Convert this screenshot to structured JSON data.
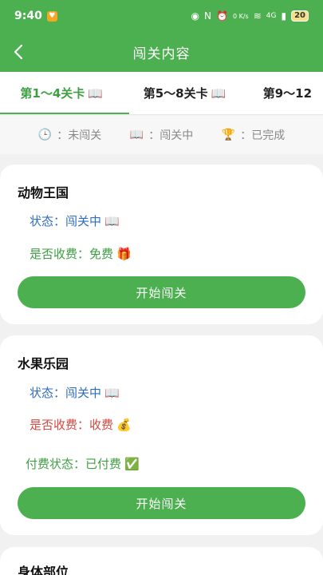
{
  "status_bar": {
    "time": "9:40",
    "net_speed": "0 K/s",
    "signal": "4G",
    "battery": "20"
  },
  "header": {
    "title": "闯关内容"
  },
  "tabs": [
    {
      "label": "第1～4关卡",
      "active": true
    },
    {
      "label": "第5～8关卡",
      "active": false
    },
    {
      "label": "第9～12",
      "active": false
    }
  ],
  "legend": [
    {
      "icon": "clock-icon",
      "label": "：未闯关"
    },
    {
      "icon": "book-icon",
      "label": "：闯关中"
    },
    {
      "icon": "trophy-icon",
      "label": "：已完成"
    }
  ],
  "cards": [
    {
      "name": "动物王国",
      "status": "状态：闯关中",
      "fee": "是否收费：免费",
      "button": "开始闯关"
    },
    {
      "name": "水果乐园",
      "status": "状态：闯关中",
      "fee": "是否收费：收费",
      "pay_status": "付费状态：已付费",
      "button": "开始闯关"
    },
    {
      "name": "身体部位"
    }
  ],
  "colors": {
    "brand": "#4caf50",
    "status_blue": "#2d6cc0",
    "fee_red": "#d9473f"
  }
}
